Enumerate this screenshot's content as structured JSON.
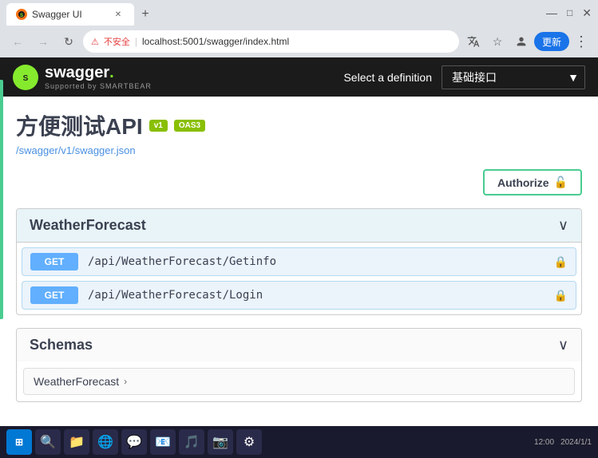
{
  "browser": {
    "tab_label": "Swagger UI",
    "url": "localhost:5001/swagger/index.html",
    "not_secure_label": "不安全",
    "update_btn_label": "更新",
    "new_tab_symbol": "+"
  },
  "swagger": {
    "logo_text": "S",
    "brand_name": "swagger.",
    "brand_sub": "Supported by SMARTBEAR",
    "select_definition_label": "Select a definition",
    "definition_option": "基础接口"
  },
  "api": {
    "title": "方便测试API",
    "badge_v1": "v1",
    "badge_oas3": "OAS3",
    "swagger_json_link": "/swagger/v1/swagger.json",
    "authorize_btn_label": "Authorize"
  },
  "weather_section": {
    "title": "WeatherForecast",
    "chevron": "∨",
    "endpoints": [
      {
        "method": "GET",
        "path": "/api/WeatherForecast/Getinfo",
        "has_lock": true
      },
      {
        "method": "GET",
        "path": "/api/WeatherForecast/Login",
        "has_lock": true
      }
    ]
  },
  "schemas_section": {
    "title": "Schemas",
    "chevron": "∨",
    "items": [
      {
        "name": "WeatherForecast",
        "expand_label": "›"
      }
    ]
  },
  "taskbar": {
    "icons": [
      "⊞",
      "🔍",
      "📁",
      "🌐",
      "💬",
      "📧",
      "🎵",
      "📷",
      "⚙"
    ]
  }
}
